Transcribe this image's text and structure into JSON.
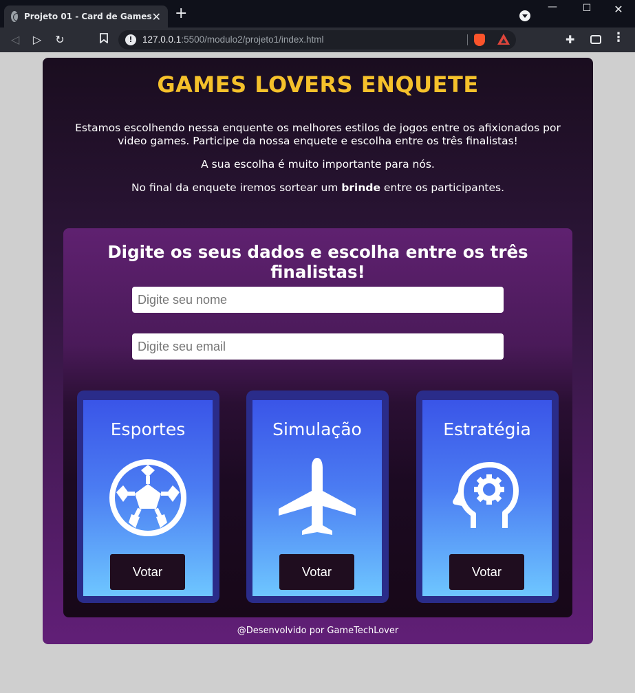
{
  "browser": {
    "tab_title": "Projeto 01 - Card de Games",
    "tab_close": "✕",
    "new_tab": "+",
    "url_host": "127.0.0.1",
    "url_rest": ":5500/modulo2/projeto1/index.html",
    "window_min": "—",
    "window_max": "☐",
    "window_close": "✕",
    "icons": [
      "globe-icon",
      "back-icon",
      "forward-icon",
      "reload-icon",
      "bookmark-icon",
      "info-icon",
      "brave-shield-icon",
      "brave-rewards-icon",
      "extensions-icon",
      "wallet-icon",
      "menu-icon"
    ]
  },
  "page": {
    "title": "GAMES LOVERS ENQUETE",
    "intro_p1": "Estamos escolhendo nessa enquente os melhores estilos de jogos entre os afixionados por video games. Participe da nossa enquete e escolha entre os três finalistas!",
    "intro_p2": "A sua escolha é muito importante para nós.",
    "intro_p3_before": "No final da enquete iremos sortear um ",
    "intro_p3_bold": "brinde",
    "intro_p3_after": " entre os participantes.",
    "title_color": "#f5c12b"
  },
  "form": {
    "heading": "Digite os seus dados e escolha entre os três finalistas!",
    "name_placeholder": "Digite seu nome",
    "email_placeholder": "Digite seu email"
  },
  "cards": [
    {
      "title": "Esportes",
      "icon": "soccer-ball-icon",
      "button": "Votar"
    },
    {
      "title": "Simulação",
      "icon": "airplane-icon",
      "button": "Votar"
    },
    {
      "title": "Estratégia",
      "icon": "head-gear-icon",
      "button": "Votar"
    }
  ],
  "footer": "@Desenvolvido por GameTechLover"
}
